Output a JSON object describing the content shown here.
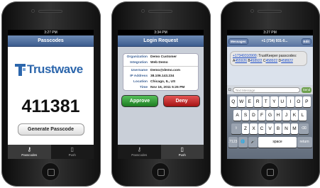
{
  "phone1": {
    "status_time": "3:27 PM",
    "nav_title": "Passcodes",
    "logo_text": "Trustwave",
    "passcode": "411381",
    "generate_label": "Generate Passcode",
    "tabs": [
      "Passcodes",
      "Push"
    ]
  },
  "phone2": {
    "status_time": "3:34 PM",
    "nav_title": "Login Request",
    "fields": [
      {
        "label": "Organization",
        "value": "Demo Customer"
      },
      {
        "label": "Integration",
        "value": "Web Demo"
      },
      {
        "label": "Username",
        "value": "Demo@demo.com"
      },
      {
        "label": "IP Address",
        "value": "38.106.143.234"
      },
      {
        "label": "Location",
        "value": "Chicago, IL, US"
      },
      {
        "label": "Time",
        "value": "Nov 16, 2011 5:26 PM"
      }
    ],
    "approve_label": "Approve",
    "deny_label": "Deny",
    "tabs": [
      "Passcodes",
      "Push"
    ]
  },
  "phone3": {
    "status_time": "3:27 PM",
    "back_label": "Messages",
    "nav_title": "+1 (734) 931-0...",
    "edit_label": "Edit",
    "sms_link": "+17349310900",
    "sms_text1": ": TrustKeeper passcodes: A",
    "sms_code_a": "455926",
    "sms_b_prefix": "B",
    "sms_code_b": "458922",
    "sms_c_prefix": "C",
    "sms_code_c": "458922",
    "sms_d_prefix": "D",
    "sms_code_d": "458922",
    "text_placeholder": "Text Message",
    "send_label": "Send",
    "keyboard": {
      "row1": [
        "Q",
        "W",
        "E",
        "R",
        "T",
        "Y",
        "U",
        "I",
        "O",
        "P"
      ],
      "row2": [
        "A",
        "S",
        "D",
        "F",
        "G",
        "H",
        "J",
        "K",
        "L"
      ],
      "row3": [
        "⇧",
        "Z",
        "X",
        "C",
        "V",
        "B",
        "N",
        "M",
        "⌫"
      ],
      "row4": [
        ".?123",
        "🌐",
        "🎤",
        "space",
        "return"
      ]
    }
  },
  "colors": {
    "brand": "#2c66ac",
    "approve": "#2e9a33",
    "deny": "#c62222"
  }
}
